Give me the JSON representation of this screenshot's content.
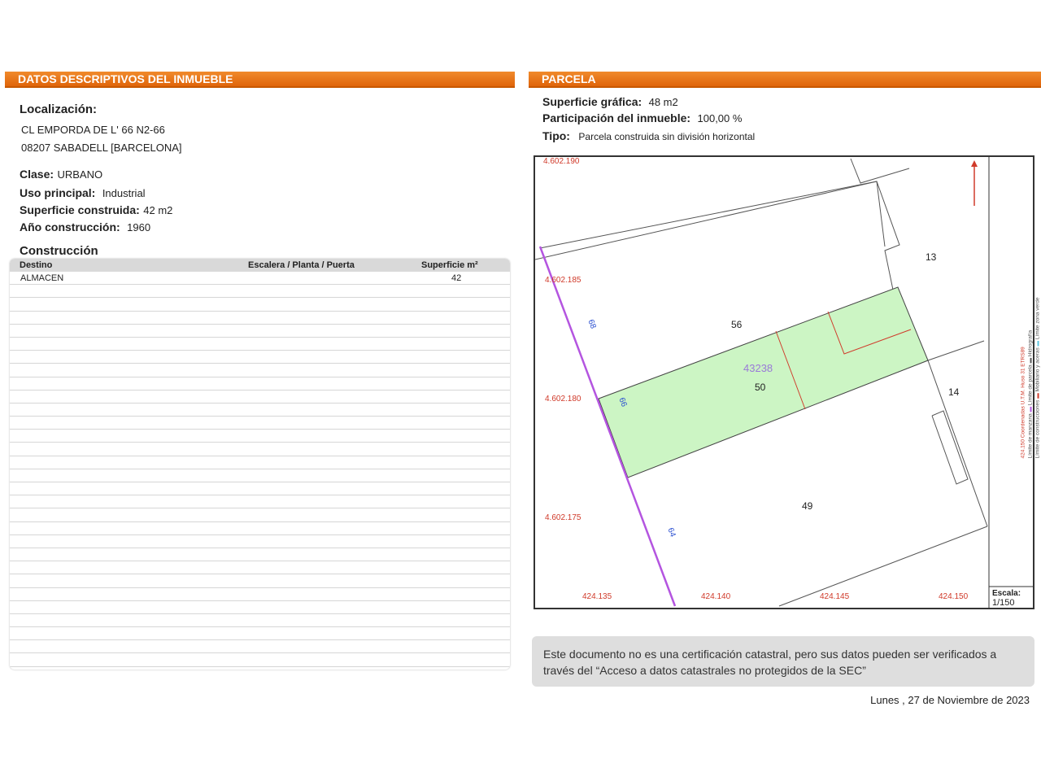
{
  "left_panel": {
    "header": "DATOS DESCRIPTIVOS DEL INMUEBLE",
    "localizacion_label": "Localización:",
    "address_line1": "CL EMPORDA DE L' 66 N2-66",
    "address_line2": "08207 SABADELL [BARCELONA]",
    "clase_label": "Clase:",
    "clase_value": "URBANO",
    "uso_label": "Uso principal:",
    "uso_value": "Industrial",
    "superficie_label": "Superficie construida:",
    "superficie_value": "42 m2",
    "anio_label": "Año construcción:",
    "anio_value": "1960",
    "construccion_title": "Construcción",
    "table": {
      "columns": [
        "Destino",
        "Escalera / Planta / Puerta",
        "Superficie m²"
      ],
      "rows": [
        {
          "destino": "ALMACEN",
          "escalera": "",
          "superficie": "42"
        }
      ],
      "empty_rows": 29
    }
  },
  "right_panel": {
    "header": "PARCELA",
    "sup_grafica_label": "Superficie gráfica:",
    "sup_grafica_value": "48 m2",
    "participacion_label": "Participación del inmueble:",
    "participacion_value": "100,00 %",
    "tipo_label": "Tipo:",
    "tipo_value": "Parcela construida sin división horizontal",
    "map": {
      "parcel_ref": "43238",
      "parcel_numbers": [
        "56",
        "50",
        "49",
        "13",
        "14"
      ],
      "street_numbers": [
        "68",
        "66",
        "64"
      ],
      "y_coords": [
        "4.602.190",
        "4.602.185",
        "4.602.180",
        "4.602.175"
      ],
      "x_coords": [
        "424.135",
        "424.140",
        "424.145",
        "424.150"
      ],
      "scale_label": "Escala:",
      "scale_value": "1/150",
      "legend": {
        "coords_note": "424.150 Coordenadas U.T.M. Huso 31 ETRS89",
        "limite_manzana": "Límite de manzana",
        "limite_construcciones": "Límite de construcciones",
        "limite_parcela": "Límite de parcela",
        "mobiliario": "Mobiliario y aceras",
        "hidrografia": "Hidrografía",
        "zona_verde": "Límite zona verde"
      },
      "colors": {
        "parcel_fill": "#ccf5c4",
        "street_line": "#b455e0",
        "construction_line": "#d03a2a",
        "coord_text": "#d03a2a"
      }
    },
    "notice": "Este documento no es una certificación catastral, pero sus datos pueden ser verificados a través del “Acceso a datos catastrales no protegidos de la SEC”",
    "date": "Lunes , 27 de Noviembre de 2023"
  },
  "accent_color": "#e86c12"
}
